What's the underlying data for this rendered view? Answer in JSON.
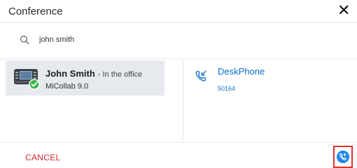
{
  "dialog": {
    "title": "Conference",
    "close_label": "✕"
  },
  "search": {
    "value": "john smith",
    "icon": "search-icon"
  },
  "contacts": [
    {
      "name": "John Smith",
      "status": "- In the office",
      "app": "MiCollab 9.0",
      "presence": "available",
      "avatar_icon": "desk-phone-avatar"
    }
  ],
  "devices": [
    {
      "name": "DeskPhone",
      "number": "50164",
      "icon": "incoming-call-icon"
    }
  ],
  "footer": {
    "cancel_label": "CANCEL",
    "call_icon": "add-call-icon"
  },
  "colors": {
    "accent_blue": "#1e88e5",
    "link_blue": "#0a6fc6",
    "cancel_red": "#d3262e",
    "selection_bg": "#e6e9ed",
    "presence_green": "#3bb34a"
  }
}
